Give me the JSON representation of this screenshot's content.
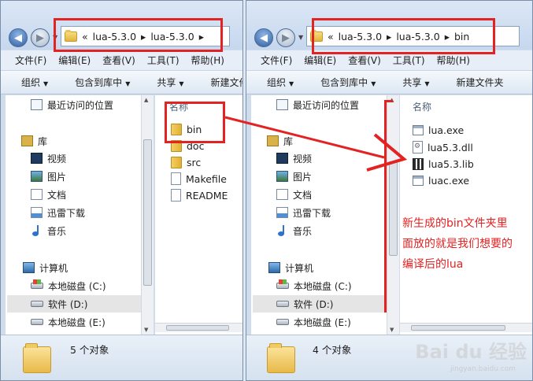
{
  "windows": [
    {
      "address": {
        "sep": "«",
        "parts": [
          "lua-5.3.0",
          "lua-5.3.0"
        ]
      },
      "menu": [
        "文件(F)",
        "编辑(E)",
        "查看(V)",
        "工具(T)",
        "帮助(H)"
      ],
      "toolbar": [
        "组织",
        "包含到库中",
        "共享",
        "新建文件"
      ],
      "nav": {
        "recent": "最近访问的位置",
        "library": "库",
        "lib_items": [
          "视频",
          "图片",
          "文档",
          "迅雷下载",
          "音乐"
        ],
        "computer": "计算机",
        "drives": [
          "本地磁盘 (C:)",
          "软件 (D:)",
          "本地磁盘 (E:)"
        ]
      },
      "column_header": "名称",
      "files": [
        "bin",
        "doc",
        "src",
        "Makefile",
        "README"
      ],
      "status": "5 个对象"
    },
    {
      "address": {
        "sep": "«",
        "parts": [
          "lua-5.3.0",
          "lua-5.3.0",
          "bin"
        ]
      },
      "menu": [
        "文件(F)",
        "编辑(E)",
        "查看(V)",
        "工具(T)",
        "帮助(H)"
      ],
      "toolbar": [
        "组织",
        "包含到库中",
        "共享",
        "新建文件夹"
      ],
      "nav": {
        "recent": "最近访问的位置",
        "library": "库",
        "lib_items": [
          "视频",
          "图片",
          "文档",
          "迅雷下载",
          "音乐"
        ],
        "computer": "计算机",
        "drives": [
          "本地磁盘 (C:)",
          "软件 (D:)",
          "本地磁盘 (E:)"
        ]
      },
      "column_header": "名称",
      "files": [
        "lua.exe",
        "lua5.3.dll",
        "lua5.3.lib",
        "luac.exe"
      ],
      "status": "4 个对象"
    }
  ],
  "annotation": {
    "lines": [
      "新生成的bin文件夹里",
      "面放的就是我们想要的",
      "编译后的lua"
    ],
    "color": "#e32222"
  },
  "watermark": {
    "brand": "Bai du 经验",
    "url": "jingyan.baidu.com"
  }
}
